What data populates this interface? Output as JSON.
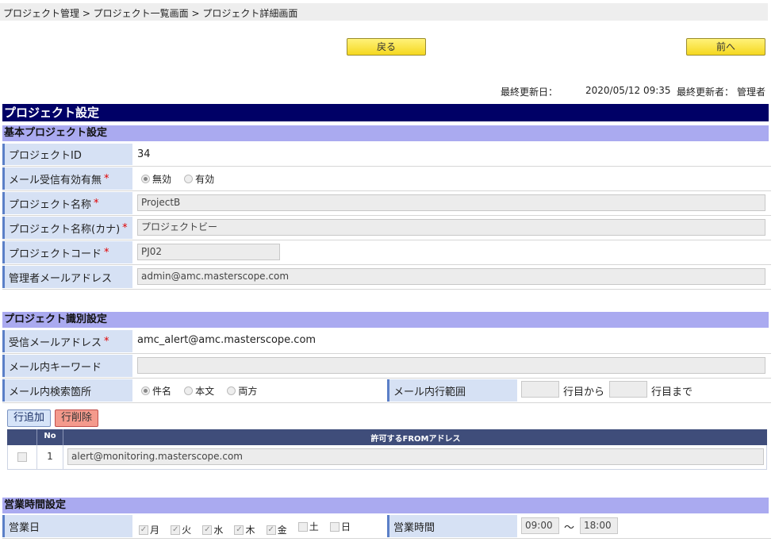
{
  "breadcrumb": "プロジェクト管理 > プロジェクト一覧画面 > プロジェクト詳細画面",
  "buttons": {
    "back": "戻る",
    "prev": "前へ"
  },
  "update": {
    "date_label": "最終更新日：",
    "date_value": "2020/05/12 09:35",
    "user_label": "最終更新者：",
    "user_value": "管理者"
  },
  "section_title": "プロジェクト設定",
  "basic": {
    "title": "基本プロジェクト設定",
    "id_label": "プロジェクトID",
    "id_value": "34",
    "mail_enable_label": "メール受信有効有無",
    "opt_disabled": "無効",
    "opt_enabled": "有効",
    "name_label": "プロジェクト名称",
    "name_value": "ProjectB",
    "kana_label": "プロジェクト名称(カナ)",
    "kana_value": "プロジェクトビー",
    "code_label": "プロジェクトコード",
    "code_value": "PJ02",
    "admin_mail_label": "管理者メールアドレス",
    "admin_mail_value": "admin@amc.masterscope.com",
    "required_mark": "*"
  },
  "ident": {
    "title": "プロジェクト識別設定",
    "recv_label": "受信メールアドレス",
    "recv_value": "amc_alert@amc.masterscope.com",
    "keyword_label": "メール内キーワード",
    "keyword_value": "",
    "search_label": "メール内検索箇所",
    "opt_subject": "件名",
    "opt_body": "本文",
    "opt_both": "両方",
    "range_label": "メール内行範囲",
    "range_from_suffix": "行目から",
    "range_to_suffix": "行目まで",
    "add_row": "行追加",
    "del_row": "行削除",
    "col_no": "No",
    "col_from": "許可するFROMアドレス",
    "rows": [
      {
        "no": "1",
        "address": "alert@monitoring.masterscope.com"
      }
    ]
  },
  "biz": {
    "title": "営業時間設定",
    "days_label": "営業日",
    "days": [
      "月",
      "火",
      "水",
      "木",
      "金",
      "土",
      "日"
    ],
    "checked": [
      true,
      true,
      true,
      true,
      true,
      false,
      false
    ],
    "hours_label": "営業時間",
    "start": "09:00",
    "tilde": "〜",
    "end": "18:00"
  }
}
